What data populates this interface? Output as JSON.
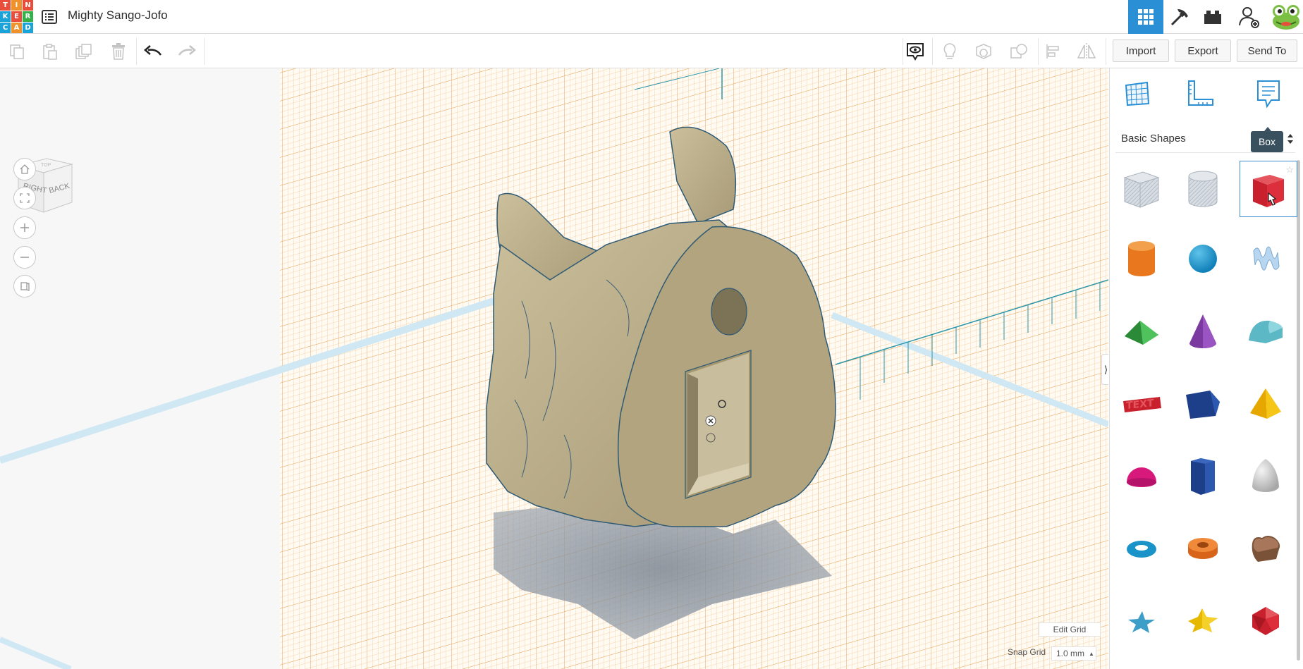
{
  "app": {
    "logo_letters": [
      "T",
      "I",
      "N",
      "K",
      "E",
      "R",
      "C",
      "A",
      "D"
    ],
    "logo_colors": [
      "#e94e3d",
      "#f0922b",
      "#e94e3d",
      "#1aa3d8",
      "#e94e3d",
      "#36b14a",
      "#1aa3d8",
      "#f0922b",
      "#1aa3d8"
    ],
    "design_title": "Mighty Sango-Jofo",
    "accent_color": "#2b8fd6"
  },
  "toolbar": {
    "copy_icon": "copy-icon",
    "paste_icon": "paste-icon",
    "duplicate_icon": "duplicate-icon",
    "delete_icon": "trash-icon",
    "undo_icon": "undo-icon",
    "redo_icon": "redo-icon",
    "import_label": "Import",
    "export_label": "Export",
    "send_to_label": "Send To"
  },
  "viewcube": {
    "face_right": "RIGHT",
    "face_back": "BACK",
    "face_top": "TOP"
  },
  "workplane": {
    "edit_grid_label": "Edit Grid",
    "snap_grid_label": "Snap Grid",
    "snap_grid_value": "1.0 mm",
    "grid_color": "#f2b066",
    "model_color": "#b8a981"
  },
  "panel": {
    "category": "Basic Shapes",
    "tooltip": "Box",
    "shapes": [
      "Box Hole",
      "Cylinder Hole",
      "Box",
      "Cylinder",
      "Sphere",
      "Scribble",
      "Roof",
      "Cone",
      "Round Roof",
      "Text",
      "Wedge",
      "Pyramid",
      "Half Sphere",
      "Polygon",
      "Paraboloid",
      "Torus",
      "Tube",
      "Heart",
      "Star",
      "Star",
      "Icosahedron"
    ]
  }
}
